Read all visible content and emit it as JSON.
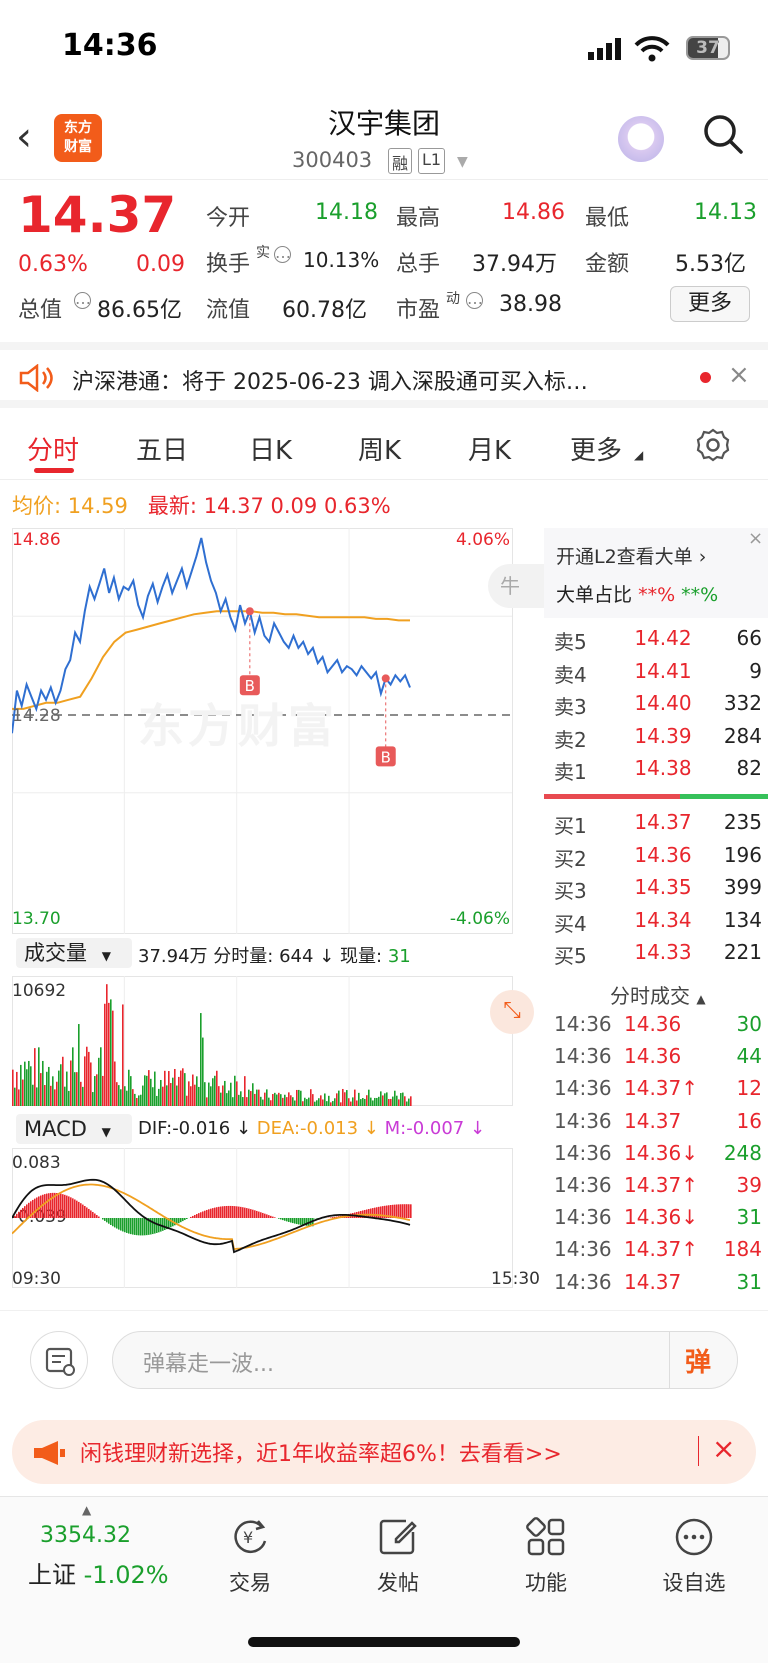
{
  "status_bar": {
    "time": "14:36",
    "battery": "37"
  },
  "header": {
    "logo_text_1": "东方",
    "logo_text_2": "财富",
    "title": "汉宇集团",
    "code": "300403",
    "tag1": "融",
    "tag2": "L1"
  },
  "quote": {
    "price": "14.37",
    "change_pct": "0.63%",
    "change": "0.09",
    "open_label": "今开",
    "open": "14.18",
    "high_label": "最高",
    "high": "14.86",
    "low_label": "最低",
    "low": "14.13",
    "turnover_label": "换手",
    "turnover_sup": "实",
    "turnover": "10.13%",
    "volume_label": "总手",
    "volume": "37.94万",
    "amount_label": "金额",
    "amount": "5.53亿",
    "mktcap_label": "总值",
    "mktcap": "86.65亿",
    "float_label": "流值",
    "float": "60.78亿",
    "pe_label": "市盈",
    "pe_sup": "动",
    "pe": "38.98",
    "more_btn": "更多"
  },
  "notice": {
    "text": "沪深港通：将于 2025-06-23 调入深股通可买入标…"
  },
  "tabs": [
    "分时",
    "五日",
    "日K",
    "周K",
    "月K",
    "更多"
  ],
  "infoline": {
    "avg_label": "均价:",
    "avg": "14.59",
    "last_label": "最新:",
    "last": "14.37",
    "chg": "0.09",
    "pct": "0.63%"
  },
  "chart_data": [
    {
      "type": "line",
      "title": "分时",
      "y_ticks_left": [
        "14.86",
        "14.28",
        "13.70"
      ],
      "y_ticks_right": [
        "4.06%",
        "-4.06%"
      ],
      "ylim": [
        13.7,
        14.86
      ],
      "prev_close": 14.28,
      "x_ticks": [
        "09:30",
        "15:30"
      ],
      "series": [
        {
          "name": "最新",
          "color": "#2f6fd1",
          "values": [
            14.22,
            14.36,
            14.31,
            14.38,
            14.34,
            14.3,
            14.36,
            14.33,
            14.37,
            14.32,
            14.36,
            14.43,
            14.46,
            14.55,
            14.52,
            14.62,
            14.7,
            14.66,
            14.71,
            14.76,
            14.68,
            14.73,
            14.66,
            14.7,
            14.69,
            14.72,
            14.64,
            14.6,
            14.67,
            14.71,
            14.65,
            14.7,
            14.74,
            14.68,
            14.72,
            14.76,
            14.7,
            14.75,
            14.8,
            14.86,
            14.78,
            14.72,
            14.68,
            14.62,
            14.66,
            14.6,
            14.56,
            14.64,
            14.58,
            14.62,
            14.55,
            14.6,
            14.54,
            14.52,
            14.58,
            14.55,
            14.52,
            14.5,
            14.54,
            14.5,
            14.52,
            14.48,
            14.5,
            14.45,
            14.47,
            14.42,
            14.44,
            14.46,
            14.42,
            14.44,
            14.43,
            14.41,
            14.44,
            14.42,
            14.4,
            14.42,
            14.35,
            14.4,
            14.38,
            14.41,
            14.39,
            14.41,
            14.37
          ]
        },
        {
          "name": "均价",
          "color": "#f0a020",
          "values": [
            14.3,
            14.3,
            14.31,
            14.32,
            14.32,
            14.33,
            14.34,
            14.4,
            14.47,
            14.52,
            14.55,
            14.56,
            14.57,
            14.58,
            14.59,
            14.6,
            14.61,
            14.615,
            14.62,
            14.62,
            14.62,
            14.62,
            14.615,
            14.615,
            14.61,
            14.61,
            14.605,
            14.6,
            14.6,
            14.6,
            14.6,
            14.6,
            14.595,
            14.595,
            14.59,
            14.59
          ]
        }
      ],
      "markers": [
        "B",
        "B"
      ]
    },
    {
      "type": "bar",
      "title": "成交量",
      "label": "成交量",
      "total": "37.94万",
      "minute_vol_label": "分时量:",
      "minute_vol": "644",
      "now_label": "现量:",
      "now": "31",
      "y_max_label": "10692"
    },
    {
      "type": "bar",
      "title": "MACD",
      "label": "MACD",
      "dif": "DIF:-0.016",
      "dea": "DEA:-0.013",
      "m": "M:-0.007",
      "y_top": "0.083",
      "y_bottom": "-0.039"
    }
  ],
  "order_book": {
    "promo": "开通L2查看大单",
    "big_label": "大单占比",
    "big_red": "**%",
    "big_green": "**%",
    "asks": [
      {
        "label": "卖5",
        "price": "14.42",
        "vol": "66",
        "color": "red"
      },
      {
        "label": "卖4",
        "price": "14.41",
        "vol": "9",
        "color": "red"
      },
      {
        "label": "卖3",
        "price": "14.40",
        "vol": "332",
        "color": "red"
      },
      {
        "label": "卖2",
        "price": "14.39",
        "vol": "284",
        "color": "red"
      },
      {
        "label": "卖1",
        "price": "14.38",
        "vol": "82",
        "color": "red"
      }
    ],
    "bids": [
      {
        "label": "买1",
        "price": "14.37",
        "vol": "235",
        "color": "red"
      },
      {
        "label": "买2",
        "price": "14.36",
        "vol": "196",
        "color": "red"
      },
      {
        "label": "买3",
        "price": "14.35",
        "vol": "399",
        "color": "red"
      },
      {
        "label": "买4",
        "price": "14.34",
        "vol": "134",
        "color": "red"
      },
      {
        "label": "买5",
        "price": "14.33",
        "vol": "221",
        "color": "red"
      }
    ],
    "ticks_title": "分时成交",
    "ticks": [
      {
        "time": "14:36",
        "price": "14.36",
        "vol": "30",
        "vc": "green"
      },
      {
        "time": "14:36",
        "price": "14.36",
        "vol": "44",
        "vc": "green"
      },
      {
        "time": "14:36",
        "price": "14.37↑",
        "vol": "12",
        "vc": "red"
      },
      {
        "time": "14:36",
        "price": "14.37",
        "vol": "16",
        "vc": "red"
      },
      {
        "time": "14:36",
        "price": "14.36↓",
        "vol": "248",
        "vc": "green"
      },
      {
        "time": "14:36",
        "price": "14.37↑",
        "vol": "39",
        "vc": "red"
      },
      {
        "time": "14:36",
        "price": "14.36↓",
        "vol": "31",
        "vc": "green"
      },
      {
        "time": "14:36",
        "price": "14.37↑",
        "vol": "184",
        "vc": "red"
      },
      {
        "time": "14:36",
        "price": "14.37",
        "vol": "31",
        "vc": "green"
      }
    ]
  },
  "danmu": {
    "placeholder": "弹幕走一波...",
    "btn": "弹"
  },
  "ad": {
    "text": "闲钱理财新选择，近1年收益率超6%！去看看>>"
  },
  "tabbar": {
    "index_value": "3354.32",
    "index_name": "上证",
    "index_change": "-1.02%",
    "items": [
      "交易",
      "发帖",
      "功能",
      "设自选"
    ]
  },
  "colors": {
    "up": "#e8262d",
    "down": "#1a9f2c",
    "avg": "#f0a020",
    "price_line": "#2f6fd1",
    "brand": "#f25c1a"
  }
}
